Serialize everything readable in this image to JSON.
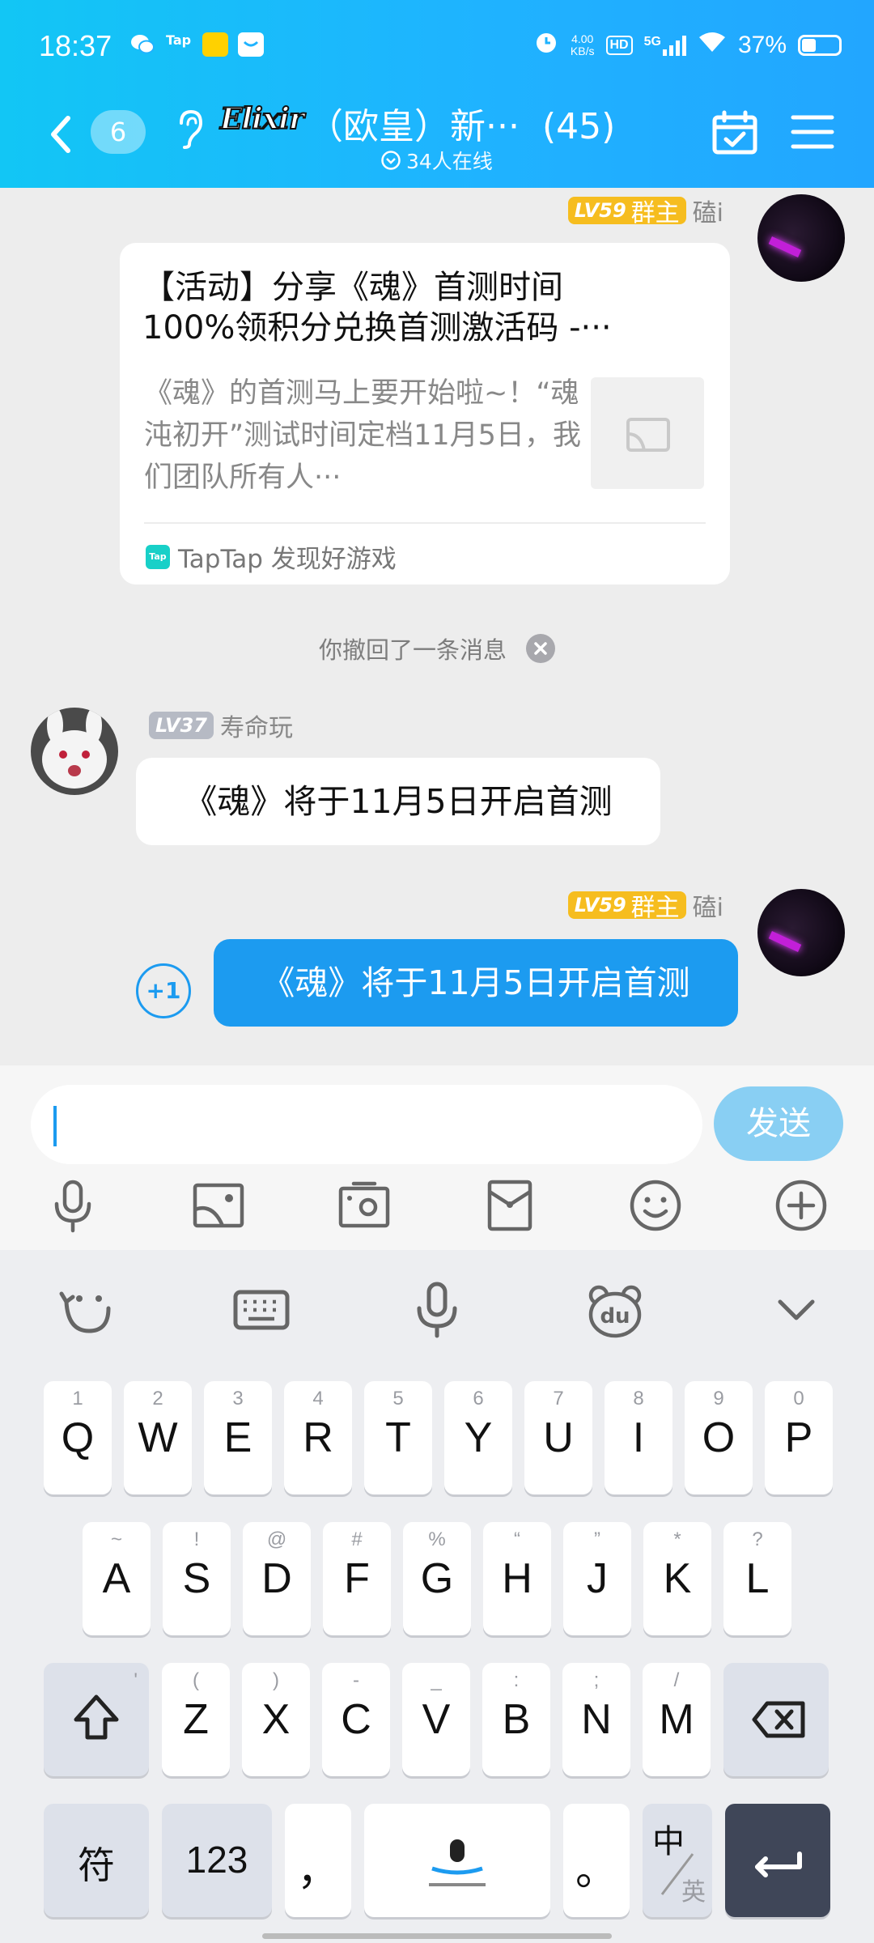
{
  "status_bar": {
    "time": "18:37",
    "net_speed_value": "4.00",
    "net_speed_unit": "KB/s",
    "hd": "HD",
    "signal": "5G",
    "battery": "37%"
  },
  "nav": {
    "unread_count": "6",
    "logo_text": "Elixir",
    "group_title": "（欧皇）新···",
    "member_count": "(45)",
    "online": "34人在线"
  },
  "messages": {
    "card": {
      "sender_level": "LV59",
      "sender_role": "群主",
      "sender_name": "磕i",
      "title_line1": "【活动】分享《魂》首测时间",
      "title_line2": "100%领积分兑换首测激活码 -···",
      "desc": "《魂》的首测马上要开始啦~！“魂沌初开”测试时间定档11月5日，我们团队所有人···",
      "source": "TapTap 发现好游戏",
      "tap_icon": "Tap"
    },
    "recall_notice": "你撤回了一条消息",
    "incoming": {
      "sender_level": "LV37",
      "sender_name": "寿命玩",
      "text": "《魂》将于11月5日开启首测"
    },
    "outgoing": {
      "sender_level": "LV59",
      "sender_role": "群主",
      "sender_name": "磕i",
      "text": "《魂》将于11月5日开启首测",
      "plus_one": "+1"
    }
  },
  "input": {
    "value": "",
    "send_label": "发送"
  },
  "keyboard": {
    "row1": [
      {
        "hint": "1",
        "key": "Q"
      },
      {
        "hint": "2",
        "key": "W"
      },
      {
        "hint": "3",
        "key": "E"
      },
      {
        "hint": "4",
        "key": "R"
      },
      {
        "hint": "5",
        "key": "T"
      },
      {
        "hint": "6",
        "key": "Y"
      },
      {
        "hint": "7",
        "key": "U"
      },
      {
        "hint": "8",
        "key": "I"
      },
      {
        "hint": "9",
        "key": "O"
      },
      {
        "hint": "0",
        "key": "P"
      }
    ],
    "row2": [
      {
        "hint": "~",
        "key": "A"
      },
      {
        "hint": "!",
        "key": "S"
      },
      {
        "hint": "@",
        "key": "D"
      },
      {
        "hint": "#",
        "key": "F"
      },
      {
        "hint": "%",
        "key": "G"
      },
      {
        "hint": "“",
        "key": "H"
      },
      {
        "hint": "”",
        "key": "J"
      },
      {
        "hint": "*",
        "key": "K"
      },
      {
        "hint": "?",
        "key": "L"
      }
    ],
    "row3": [
      {
        "hint": "(",
        "key": "Z"
      },
      {
        "hint": ")",
        "key": "X"
      },
      {
        "hint": "-",
        "key": "C"
      },
      {
        "hint": "_",
        "key": "V"
      },
      {
        "hint": ":",
        "key": "B"
      },
      {
        "hint": ";",
        "key": "N"
      },
      {
        "hint": "/",
        "key": "M"
      }
    ],
    "shift_hint": "'",
    "symbols_label": "符",
    "numbers_label": "123",
    "comma_label": "，",
    "period_label": "。",
    "lang_main": "中",
    "lang_alt": "英"
  }
}
